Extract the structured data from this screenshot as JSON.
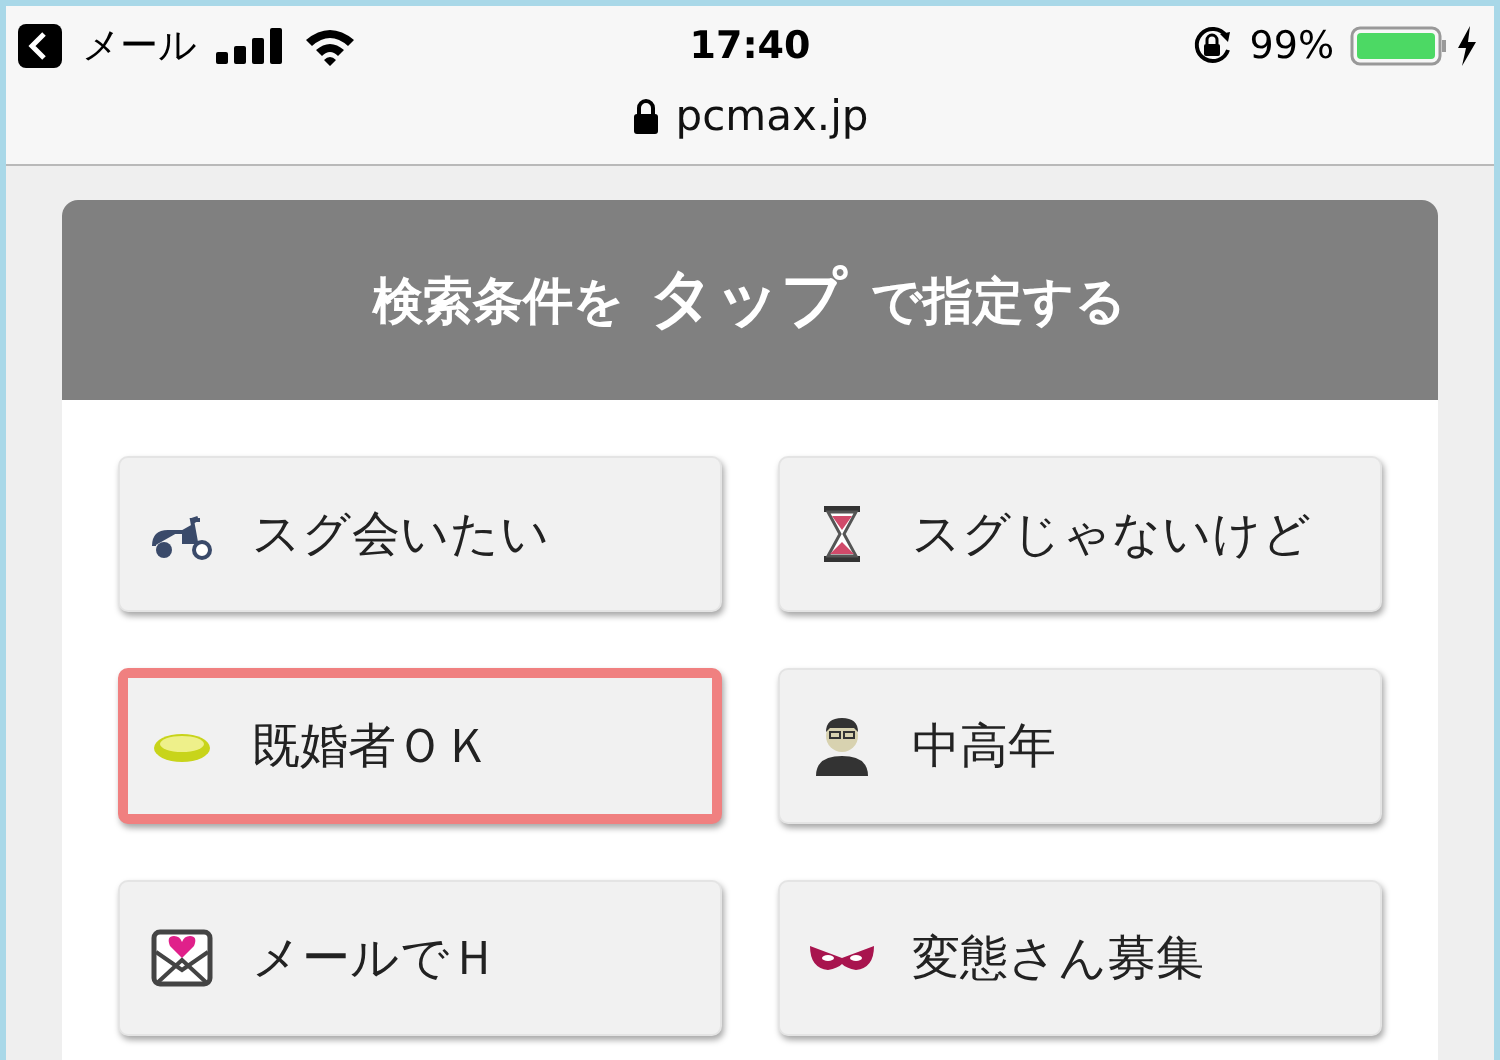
{
  "status_bar": {
    "back_label": "メール",
    "time": "17:40",
    "battery": "99%"
  },
  "address_bar": {
    "url": "pcmax.jp"
  },
  "search_panel": {
    "title_before": "検索条件を",
    "title_emphasis": "タップ",
    "title_after": "で指定する",
    "options": [
      {
        "label": "スグ会いたい",
        "kind": "scooter",
        "selected": false
      },
      {
        "label": "スグじゃないけど",
        "kind": "hourglass",
        "selected": false
      },
      {
        "label": "既婚者ＯＫ",
        "kind": "ring",
        "selected": true
      },
      {
        "label": "中高年",
        "kind": "man",
        "selected": false
      },
      {
        "label": "メールでＨ",
        "kind": "mail",
        "selected": false
      },
      {
        "label": "変態さん募集",
        "kind": "mask",
        "selected": false
      }
    ]
  }
}
